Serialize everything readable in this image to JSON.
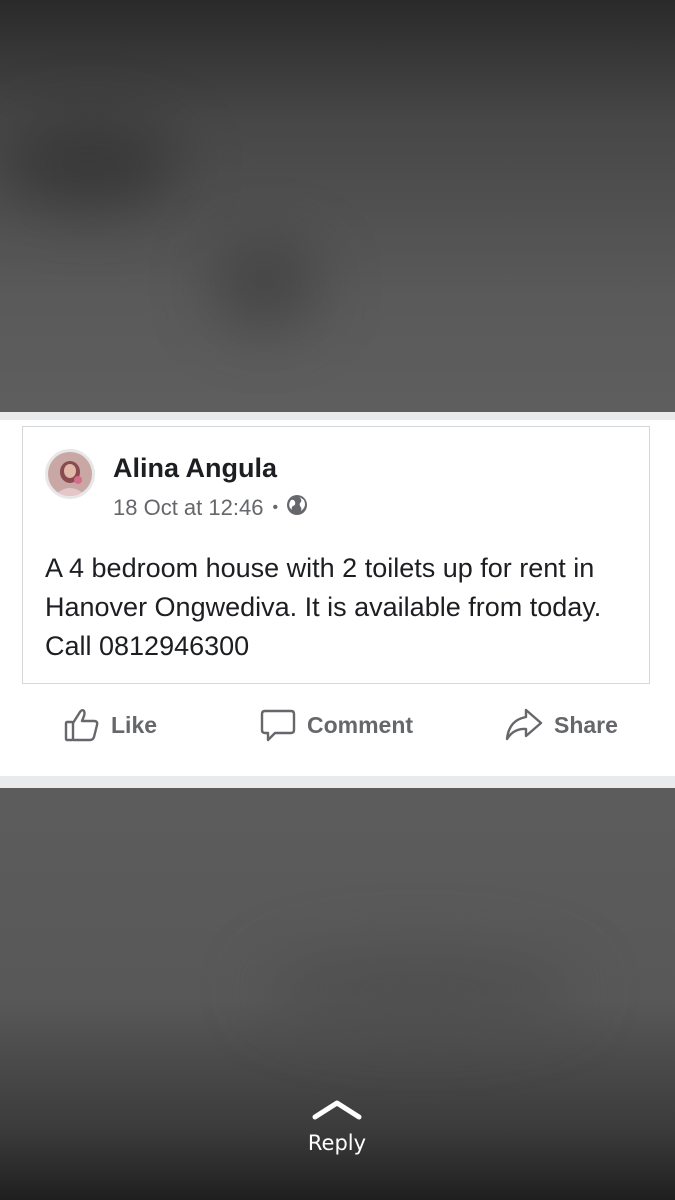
{
  "post": {
    "author": "Alina Angula",
    "timestamp": "18 Oct at 12:46",
    "separator": "•",
    "privacy_icon": "globe-icon",
    "text": "A 4 bedroom house with 2 toilets up for rent in Hanover Ongwediva. It is available from today. Call 0812946300"
  },
  "actions": {
    "like_label": "Like",
    "comment_label": "Comment",
    "share_label": "Share"
  },
  "reply": {
    "label": "Reply",
    "icon": "chevron-up-icon"
  },
  "colors": {
    "text_primary": "#1c1e21",
    "text_secondary": "#65676b",
    "card_bg": "#ffffff",
    "backdrop": "#5a5a5a"
  }
}
